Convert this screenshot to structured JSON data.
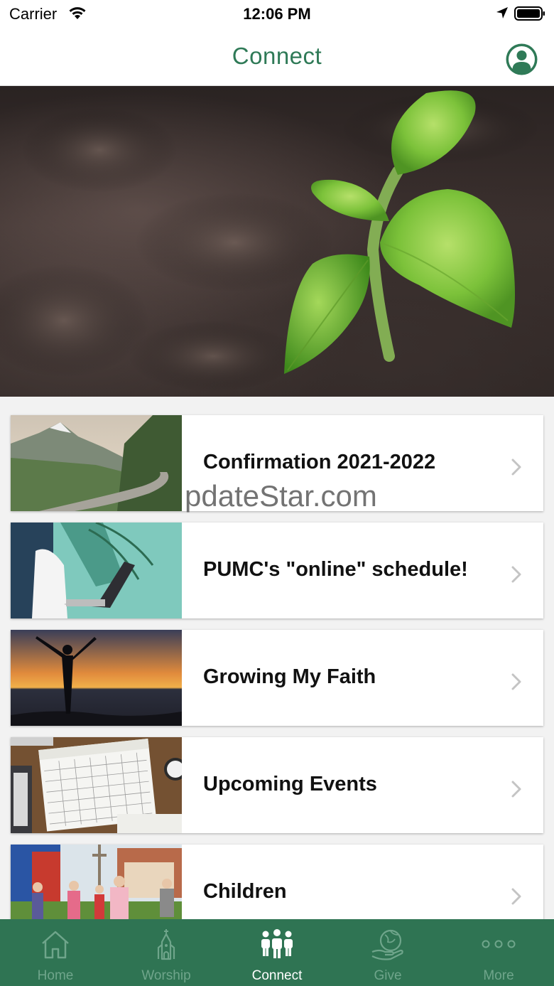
{
  "status_bar": {
    "carrier": "Carrier",
    "time": "12:06 PM"
  },
  "nav": {
    "title": "Connect",
    "profile_icon": "user-circle-icon"
  },
  "list": [
    {
      "title": "Confirmation 2021-2022",
      "thumb": "mountain-road"
    },
    {
      "title": "PUMC's \"online\" schedule!",
      "thumb": "laptop-palm"
    },
    {
      "title": "Growing My Faith",
      "thumb": "sunset-silhouette"
    },
    {
      "title": "Upcoming Events",
      "thumb": "calendar-desk"
    },
    {
      "title": "Children",
      "thumb": "children-playing"
    }
  ],
  "watermark": "pdateStar.com",
  "tabs": [
    {
      "label": "Home",
      "icon": "home-icon",
      "active": false
    },
    {
      "label": "Worship",
      "icon": "church-icon",
      "active": false
    },
    {
      "label": "Connect",
      "icon": "people-icon",
      "active": true
    },
    {
      "label": "Give",
      "icon": "giving-hand-icon",
      "active": false
    },
    {
      "label": "More",
      "icon": "more-dots-icon",
      "active": false
    }
  ],
  "colors": {
    "brand_green": "#2f7453",
    "title_green": "#2f7a57",
    "tab_inactive": "#6fa58b"
  }
}
